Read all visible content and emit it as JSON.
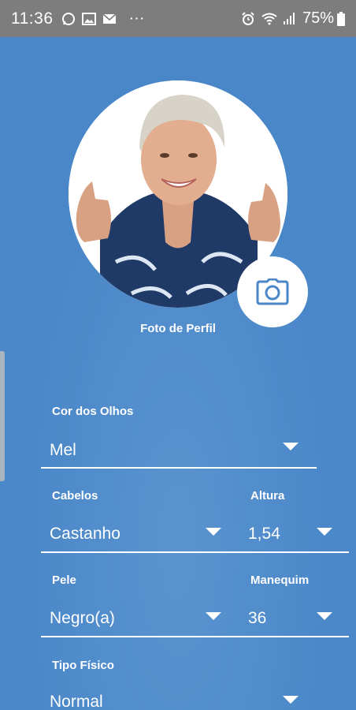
{
  "status_bar": {
    "time": "11:36",
    "icons": [
      "whatsapp-icon",
      "gallery-icon",
      "email-icon"
    ],
    "more": "···",
    "right_icons": [
      "alarm-icon",
      "wifi-icon",
      "signal-icon"
    ],
    "battery": "75%"
  },
  "profile": {
    "photo_label": "Foto de Perfil"
  },
  "form": {
    "eye_color": {
      "label": "Cor dos Olhos",
      "value": "Mel"
    },
    "hair": {
      "label": "Cabelos",
      "value": "Castanho"
    },
    "height": {
      "label": "Altura",
      "value": "1,54"
    },
    "skin": {
      "label": "Pele",
      "value": "Negro(a)"
    },
    "size": {
      "label": "Manequim",
      "value": "36"
    },
    "body_type": {
      "label": "Tipo Físico",
      "value": "Normal"
    }
  },
  "colors": {
    "background": "#4a86c8",
    "status_bar": "#7d7d7d",
    "accent": "#4a86c8",
    "text": "#ffffff"
  }
}
